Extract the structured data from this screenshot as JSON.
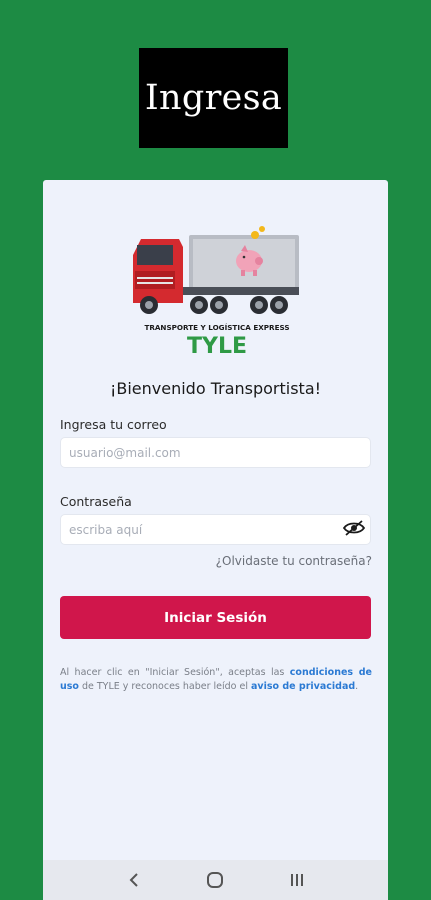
{
  "banner": {
    "title": "Ingresa"
  },
  "logo": {
    "tagline": "TRANSPORTE Y LOGÍSTICA EXPRESS",
    "brand": "TYLE"
  },
  "form": {
    "welcome": "¡Bienvenido Transportista!",
    "email_label": "Ingresa tu correo",
    "email_placeholder": "usuario@mail.com",
    "password_label": "Contraseña",
    "password_placeholder": "escriba aquí",
    "forgot_link": "¿Olvidaste tu contraseña?",
    "submit_label": "Iniciar Sesión"
  },
  "legal": {
    "part1": "Al hacer clic en \"Iniciar Sesión\", aceptas las ",
    "terms_link": "condiciones de uso",
    "part2": " de TYLE y reconoces haber leído el ",
    "privacy_link": "aviso de privacidad",
    "part3": "."
  },
  "colors": {
    "background": "#1d8b44",
    "primary_button": "#d0164b",
    "link": "#2b7ad3"
  },
  "nav": {
    "icons": [
      "back-icon",
      "home-icon",
      "recents-icon"
    ]
  }
}
